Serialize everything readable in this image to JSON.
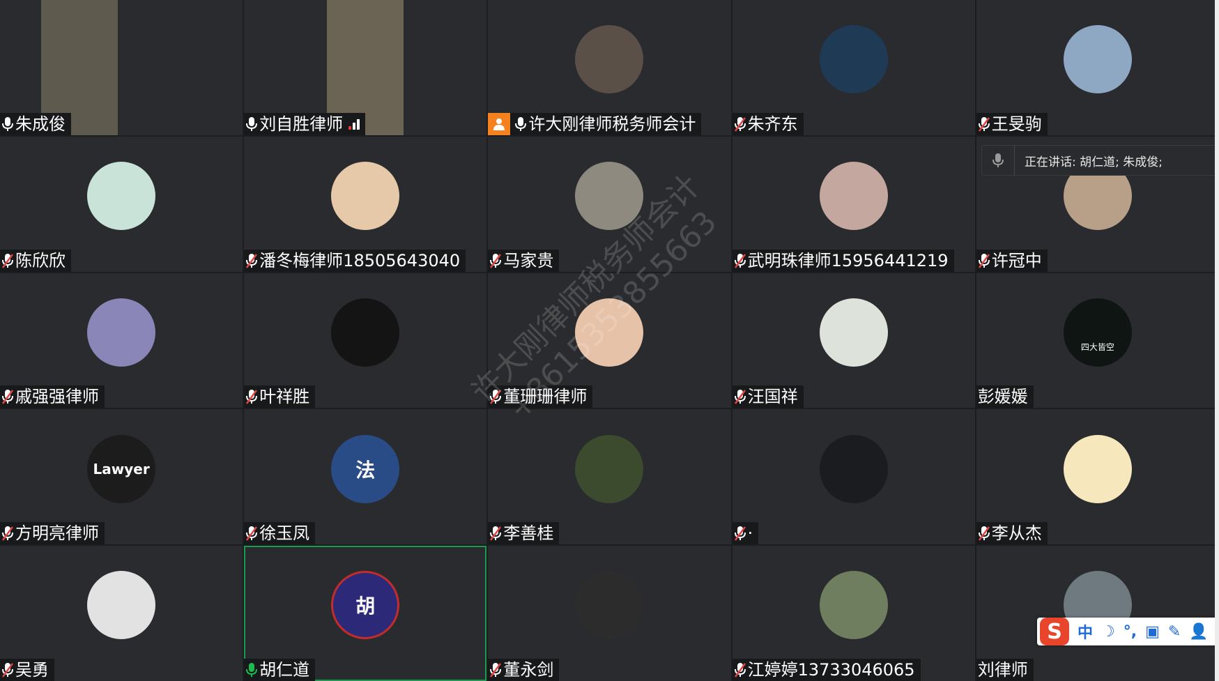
{
  "participants": [
    {
      "name": "朱成俊",
      "mic": "on",
      "video": true,
      "video_bg": "#5e5a4d"
    },
    {
      "name": "刘自胜律师",
      "mic": "on",
      "video": true,
      "video_bg": "#6b6354",
      "signal": true
    },
    {
      "name": "许大刚律师税务师会计",
      "mic": "on",
      "host": true,
      "avatar_bg": "#5a5048"
    },
    {
      "name": "朱齐东",
      "mic": "muted",
      "avatar_bg": "#1f3a55"
    },
    {
      "name": "王旻驹",
      "mic": "muted",
      "avatar_bg": "#8ea8c4"
    },
    {
      "name": "陈欣欣",
      "mic": "muted",
      "avatar_bg": "#c9e3d8"
    },
    {
      "name": "潘冬梅律师18505643040",
      "mic": "muted",
      "avatar_bg": "#e6c9a8"
    },
    {
      "name": "马家贵",
      "mic": "muted",
      "avatar_bg": "#8f8a80"
    },
    {
      "name": "武明珠律师15956441219",
      "mic": "muted",
      "avatar_bg": "#c4a8a0"
    },
    {
      "name": "许冠中",
      "mic": "muted",
      "avatar_bg": "#b8a088"
    },
    {
      "name": "戚强强律师",
      "mic": "muted",
      "avatar_bg": "#8a86b8"
    },
    {
      "name": "叶祥胜",
      "mic": "muted",
      "avatar_bg": "#141414"
    },
    {
      "name": "董珊珊律师",
      "mic": "muted",
      "avatar_bg": "#e6c2a8"
    },
    {
      "name": "汪国祥",
      "mic": "muted",
      "avatar_bg": "#dde2da"
    },
    {
      "name": "彭媛媛",
      "mic": "none",
      "avatar_bg": "#0e1512",
      "avatar_text": "四大皆空"
    },
    {
      "name": "方明亮律师",
      "mic": "muted",
      "avatar_bg": "#1c1c1c",
      "avatar_text": "Lawyer"
    },
    {
      "name": "徐玉凤",
      "mic": "muted",
      "avatar_bg": "#2a4c86",
      "avatar_text": "法"
    },
    {
      "name": "李善桂",
      "mic": "muted",
      "avatar_bg": "#3c4a2e"
    },
    {
      "name": "·",
      "mic": "muted",
      "avatar_bg": "#1a1c20"
    },
    {
      "name": "李从杰",
      "mic": "muted",
      "avatar_bg": "#f6e7bd"
    },
    {
      "name": "吴勇",
      "mic": "muted",
      "avatar_bg": "#e2e2e2"
    },
    {
      "name": "胡仁道",
      "mic": "speaking",
      "active": true,
      "avatar_bg": "#2c2a78",
      "avatar_text": "胡"
    },
    {
      "name": "董永剑",
      "mic": "muted",
      "avatar_bg": "#2c2c2c"
    },
    {
      "name": "江婷婷13733046065",
      "mic": "muted",
      "avatar_bg": "#6e7e5e"
    },
    {
      "name": "刘律师",
      "mic": "none",
      "avatar_bg": "#6e7a80"
    }
  ],
  "speaking_indicator": {
    "label": "正在讲话: 胡仁道; 朱成俊;"
  },
  "watermark": {
    "line1": "许大刚律师税务师会计",
    "line2": "+8615353855663"
  },
  "ime_toolbar": {
    "logo": "S",
    "mode": "中",
    "items": [
      "☽",
      "°,",
      "▣",
      "✎",
      "👤"
    ]
  },
  "colors": {
    "tile_bg": "#2a2b2e",
    "nametag_bg": "#18191b",
    "muted": "#e04545",
    "speaking": "#1dbb4e",
    "host_badge": "#f5821f"
  }
}
